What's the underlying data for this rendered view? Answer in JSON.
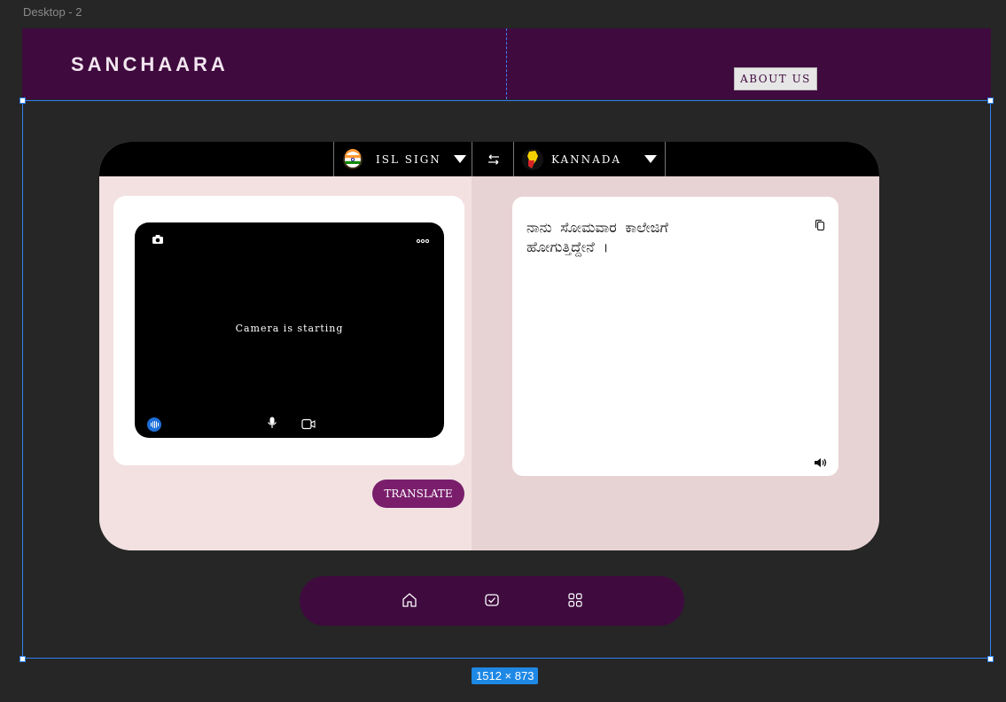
{
  "frame_label": "Desktop - 2",
  "dimensions_badge": "1512 × 873",
  "header": {
    "brand": "SANCHAARA",
    "about_label": "ABOUT US",
    "bg": "#3f0a3e"
  },
  "translator": {
    "source_lang": "ISL SIGN",
    "target_lang": "KANNADA",
    "camera_status": "Camera is starting",
    "translate_label": "TRANSLATE",
    "output_text": "ನಾನು ಸೋಮವಾರ ಕಾಲೇಜಿಗೆ\nಹೋಗುತ್ತಿದ್ದೇನೆ ।",
    "icons": [
      "india-flag-icon",
      "chevron-down-icon",
      "swap-icon",
      "karnataka-flag-icon",
      "camera-icon",
      "more-icon",
      "audio-wave-icon",
      "microphone-icon",
      "video-icon",
      "copy-icon",
      "speaker-icon"
    ]
  },
  "nav": {
    "icons": [
      "home-icon",
      "check-message-icon",
      "grid-icon"
    ]
  },
  "colors": {
    "accent": "#7a1e6c",
    "card_left": "#f3e1e2",
    "card_right": "#e8d3d4",
    "canvas": "#262626"
  }
}
